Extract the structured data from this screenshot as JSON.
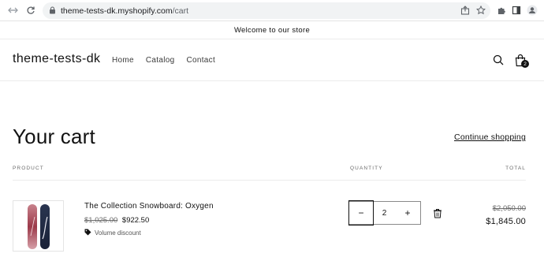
{
  "browser": {
    "url_host": "theme-tests-dk.myshopify.com",
    "url_path": "/cart",
    "icons": [
      "back-icon",
      "forward-icon",
      "reload-icon",
      "lock-icon",
      "share-icon",
      "star-icon",
      "extensions-icon",
      "sidepanel-icon",
      "profile-icon"
    ]
  },
  "announcement": "Welcome to our store",
  "header": {
    "logo": "theme-tests-dk",
    "menu": [
      "Home",
      "Catalog",
      "Contact"
    ],
    "cart_count": "2"
  },
  "cart": {
    "title": "Your cart",
    "continue_label": "Continue shopping",
    "columns": {
      "product": "PRODUCT",
      "quantity": "QUANTITY",
      "total": "TOTAL"
    },
    "items": [
      {
        "name": "The Collection Snowboard: Oxygen",
        "original_price": "$1,025.00",
        "price": "$922.50",
        "discount_label": "Volume discount",
        "quantity": "2",
        "total_original": "$2,050.00",
        "total": "$1,845.00"
      }
    ]
  },
  "colors": {
    "text": "#121212",
    "muted": "#6b6b6b",
    "border": "#ececec"
  }
}
